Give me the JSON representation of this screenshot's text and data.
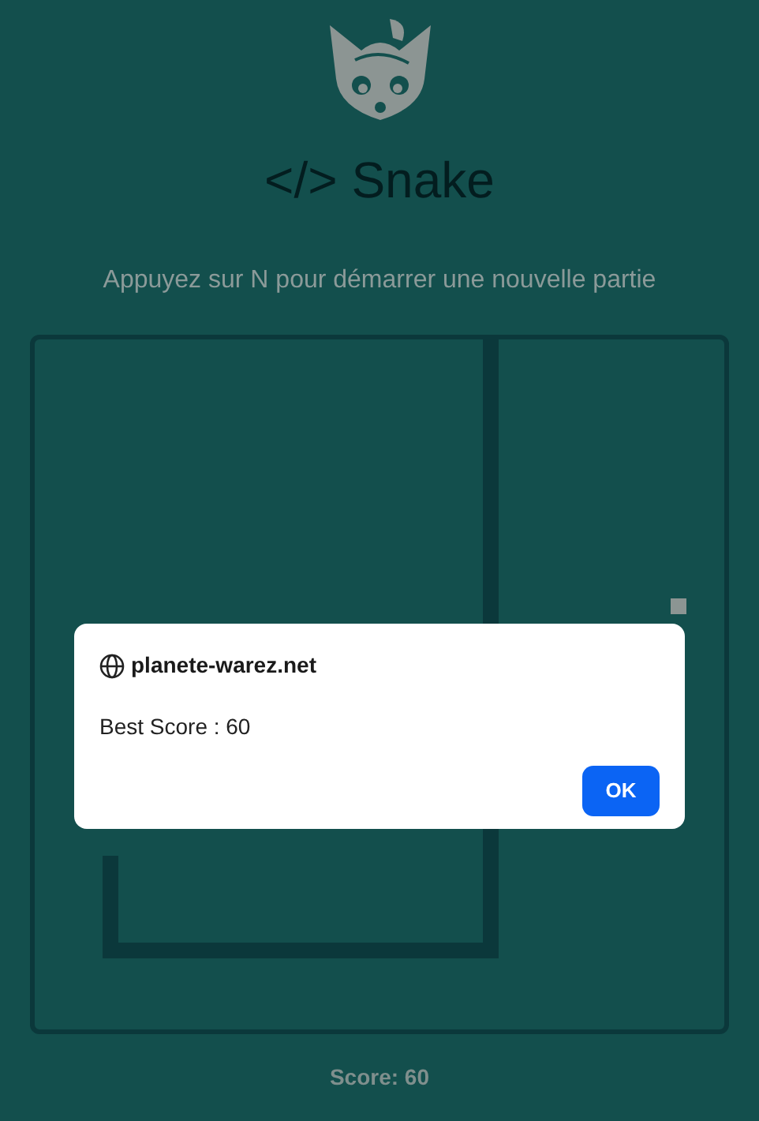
{
  "header": {
    "title": "</> Snake",
    "instruction": "Appuyez sur N pour démarrer une nouvelle partie"
  },
  "score": "Score: 60",
  "dialog": {
    "site": "planete-warez.net",
    "message": "Best Score : 60",
    "button": "OK"
  }
}
